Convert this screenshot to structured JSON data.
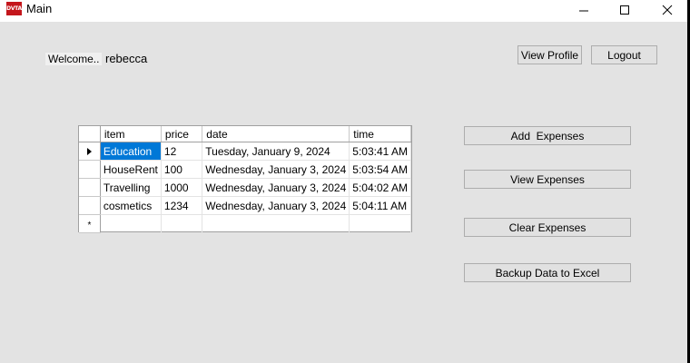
{
  "window": {
    "icon_text": "DVTA",
    "title": "Main"
  },
  "welcome": {
    "label": "Welcome..",
    "username": "rebecca"
  },
  "buttons": {
    "view_profile": "View Profile",
    "logout": "Logout",
    "add_expenses": "Add  Expenses",
    "view_expenses": "View Expenses",
    "clear_expenses": "Clear Expenses",
    "backup": "Backup Data to Excel"
  },
  "grid": {
    "columns": [
      "item",
      "price",
      "date",
      "time"
    ],
    "rows": [
      {
        "item": "Education",
        "price": "12",
        "date": "Tuesday, January 9, 2024",
        "time": "5:03:41 AM"
      },
      {
        "item": "HouseRent",
        "price": "100",
        "date": "Wednesday, January 3, 2024",
        "time": "5:03:54 AM"
      },
      {
        "item": "Travelling",
        "price": "1000",
        "date": "Wednesday, January 3, 2024",
        "time": "5:04:02 AM"
      },
      {
        "item": "cosmetics",
        "price": "1234",
        "date": "Wednesday, January 3, 2024",
        "time": "5:04:11 AM"
      }
    ],
    "new_row_marker": "*"
  },
  "colors": {
    "selection": "#0078d7",
    "app_icon": "#c4161c"
  }
}
